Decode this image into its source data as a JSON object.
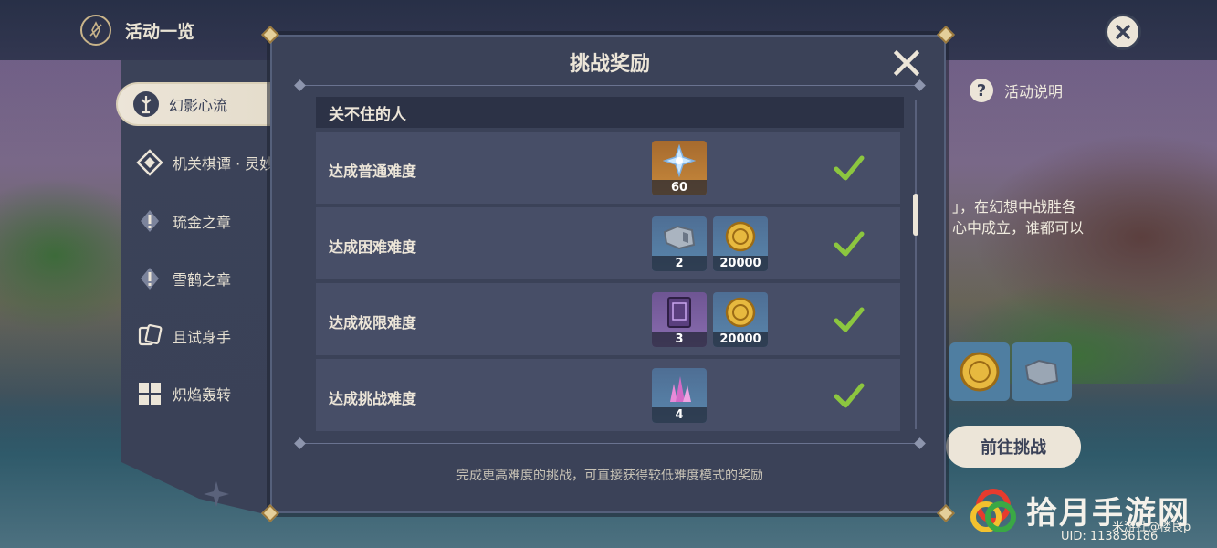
{
  "header": {
    "title": "活动一览",
    "close_icon": "close-icon"
  },
  "sidebar": {
    "items": [
      {
        "label": "幻影心流",
        "icon": "phantom-flow-icon",
        "active": true
      },
      {
        "label": "机关棋谭 · 灵妙",
        "icon": "chess-icon",
        "active": false
      },
      {
        "label": "琉金之章",
        "icon": "alert-diamond-icon",
        "active": false
      },
      {
        "label": "雪鹤之章",
        "icon": "alert-diamond-icon",
        "active": false
      },
      {
        "label": "且试身手",
        "icon": "cards-icon",
        "active": false
      },
      {
        "label": "炽焰轰转",
        "icon": "grid-icon",
        "active": false
      }
    ]
  },
  "background": {
    "help_label": "活动说明",
    "description": [
      "」，在幻想中战胜各",
      "心中成立，谁都可以"
    ],
    "go_button": "前往挑战",
    "uid": "UID: 113836186",
    "watermark": "拾月手游网",
    "watermark_sub": "米游社@楼良p"
  },
  "modal": {
    "title": "挑战奖励",
    "section_title": "关不住的人",
    "rows": [
      {
        "label": "达成普通难度",
        "rewards": [
          {
            "icon": "primogem-icon",
            "count": "60",
            "quality": "q5"
          }
        ],
        "completed": true
      },
      {
        "label": "达成困难难度",
        "rewards": [
          {
            "icon": "mora-ore-icon",
            "count": "2",
            "quality": "q3"
          },
          {
            "icon": "mora-coin-icon",
            "count": "20000",
            "quality": "q3"
          }
        ],
        "completed": true
      },
      {
        "label": "达成极限难度",
        "rewards": [
          {
            "icon": "talent-book-icon",
            "count": "3",
            "quality": "q4"
          },
          {
            "icon": "mora-coin-icon",
            "count": "20000",
            "quality": "q3"
          }
        ],
        "completed": true
      },
      {
        "label": "达成挑战难度",
        "rewards": [
          {
            "icon": "crystal-icon",
            "count": "4",
            "quality": "q3"
          }
        ],
        "completed": true
      }
    ],
    "footer_note": "完成更高难度的挑战，可直接获得较低难度模式的奖励"
  },
  "colors": {
    "panel": "#3b4258",
    "row": "#474e67",
    "check": "#8cc63f",
    "gold": "#e4cf9a",
    "cream": "#ece5d8"
  }
}
